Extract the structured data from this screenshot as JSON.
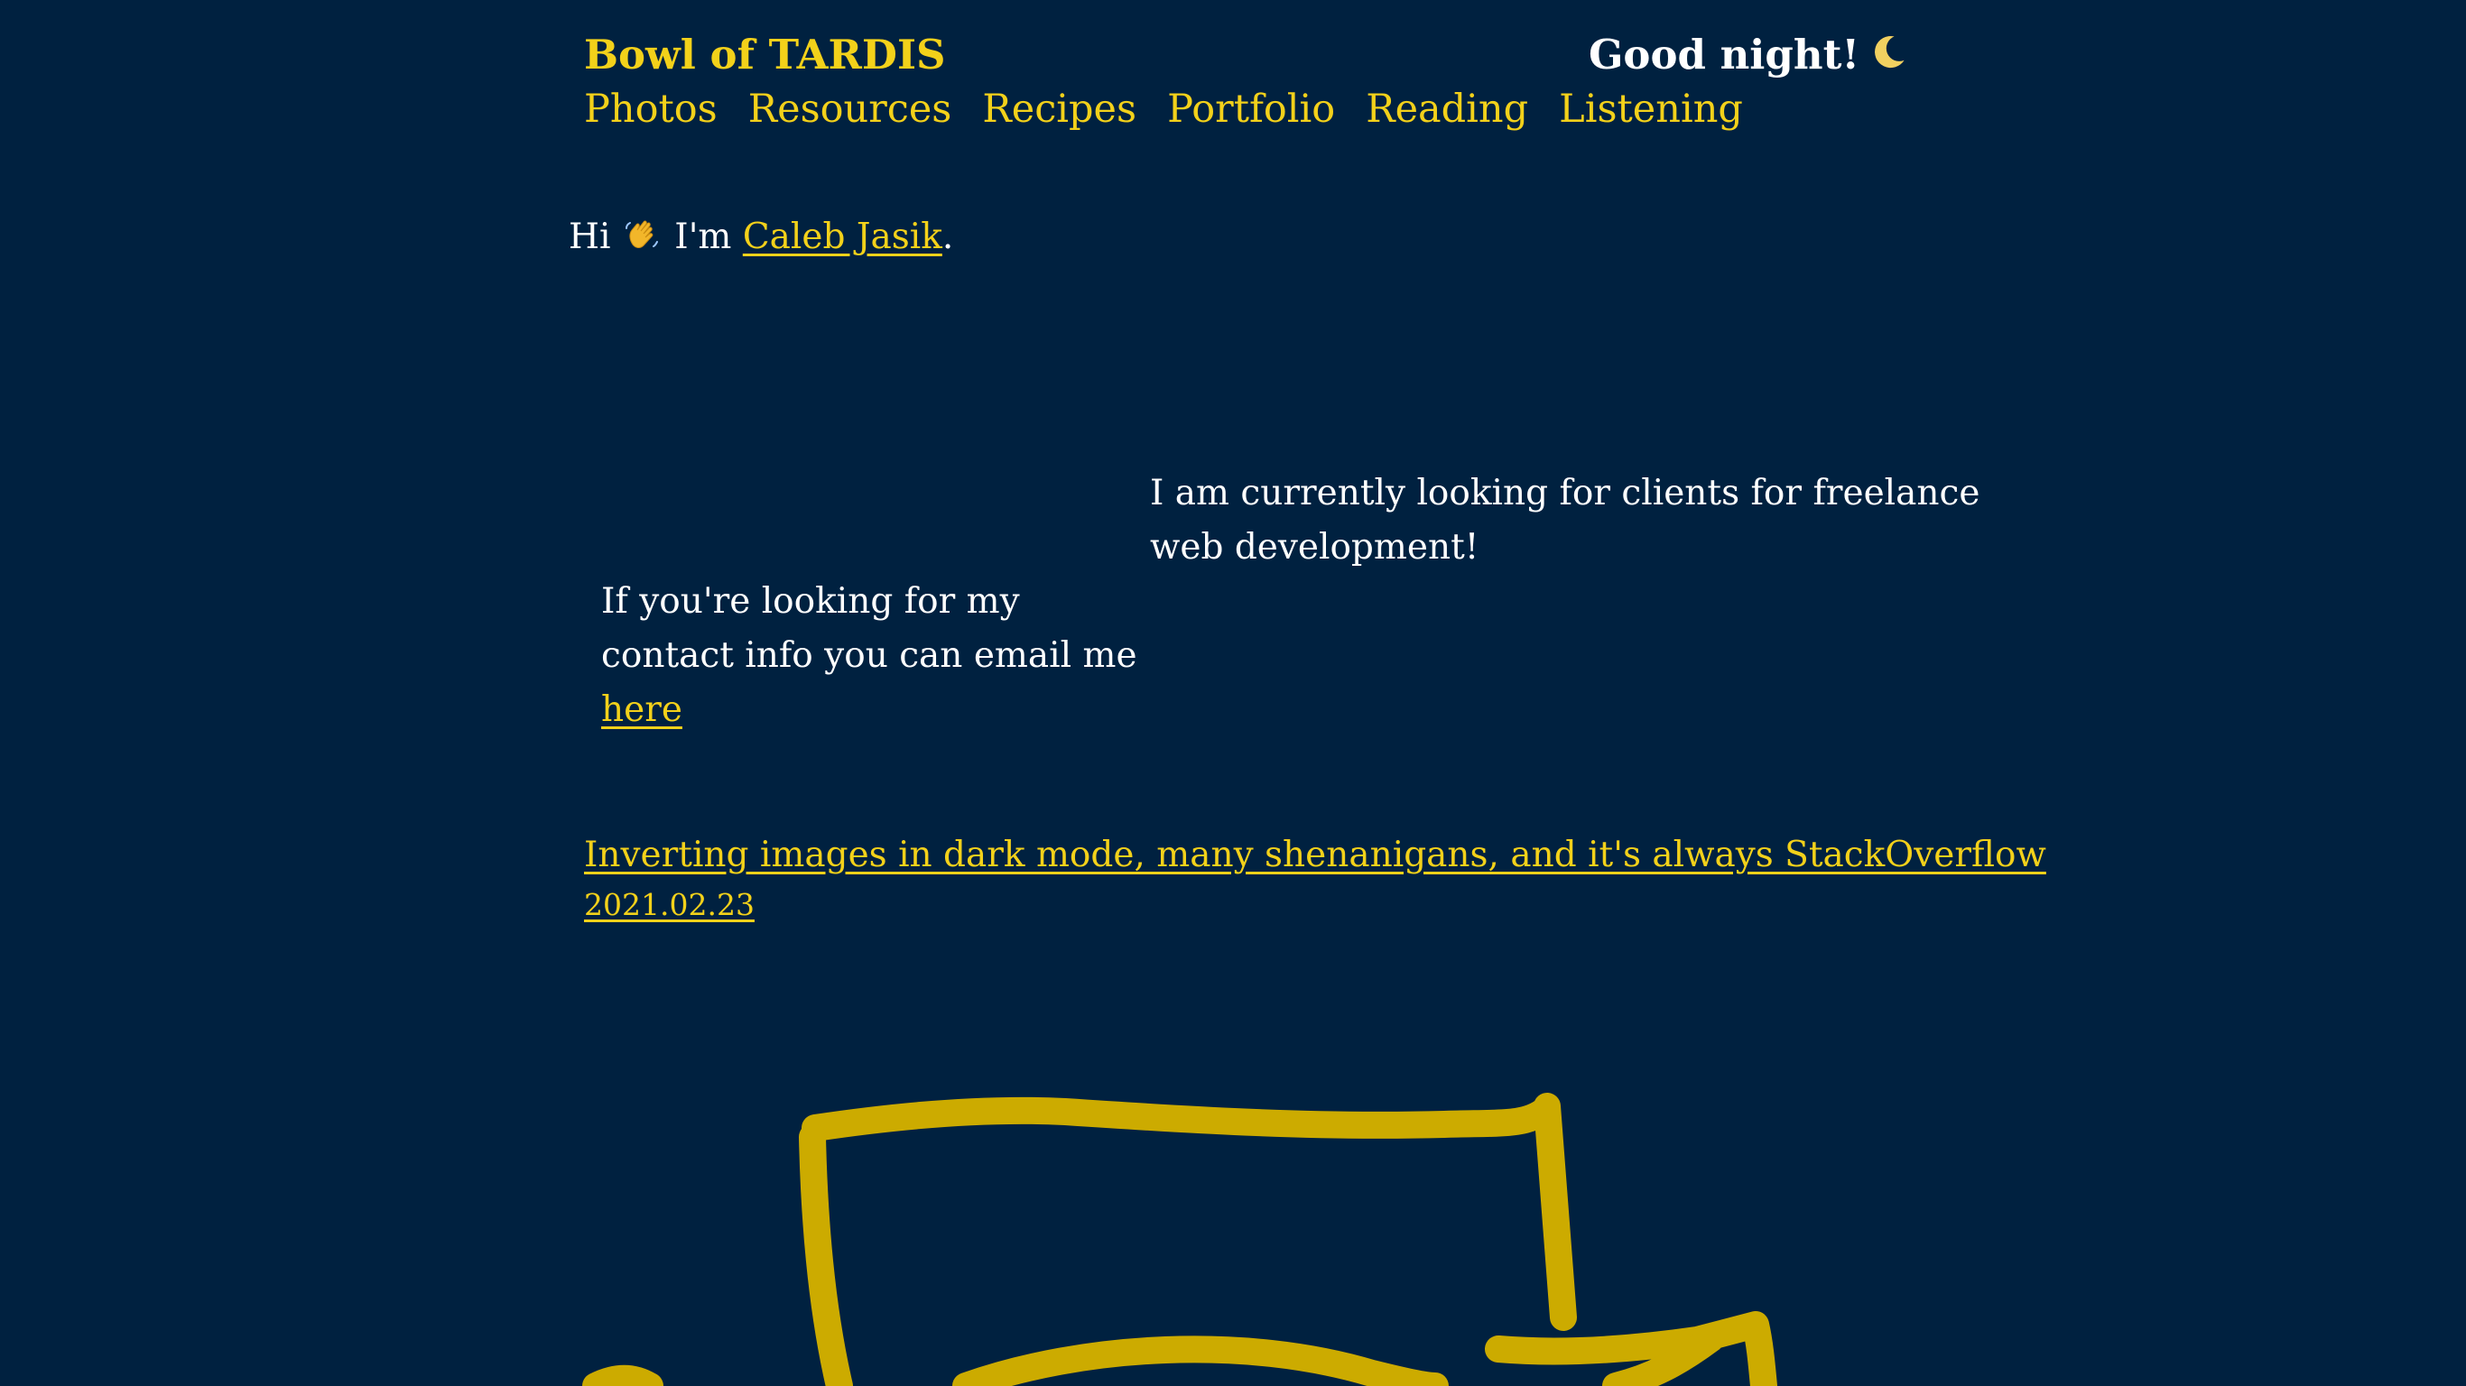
{
  "header": {
    "site_title": "Bowl of TARDIS",
    "greeting": "Good night!",
    "greeting_icon": "crescent-moon-icon"
  },
  "nav": {
    "items": [
      {
        "label": "Photos"
      },
      {
        "label": "Resources"
      },
      {
        "label": "Recipes"
      },
      {
        "label": "Portfolio"
      },
      {
        "label": "Reading"
      },
      {
        "label": "Listening"
      }
    ]
  },
  "intro": {
    "prefix": "Hi",
    "wave_icon": "waving-hand-icon",
    "middle": "I'm",
    "name_link": "Caleb Jasik",
    "suffix": "."
  },
  "freelance": {
    "text": "I am currently looking for clients for freelance web development!"
  },
  "contact": {
    "text": "If you're looking for my contact info you can email me",
    "link": "here"
  },
  "latest_post": {
    "title": "Inverting images in dark mode, many shenanigans, and it's always StackOverflow",
    "date": "2021.02.23"
  },
  "colors": {
    "background": "#002140",
    "accent": "#f3d11a",
    "doodle": "#ccab00",
    "text": "#ffffff"
  }
}
